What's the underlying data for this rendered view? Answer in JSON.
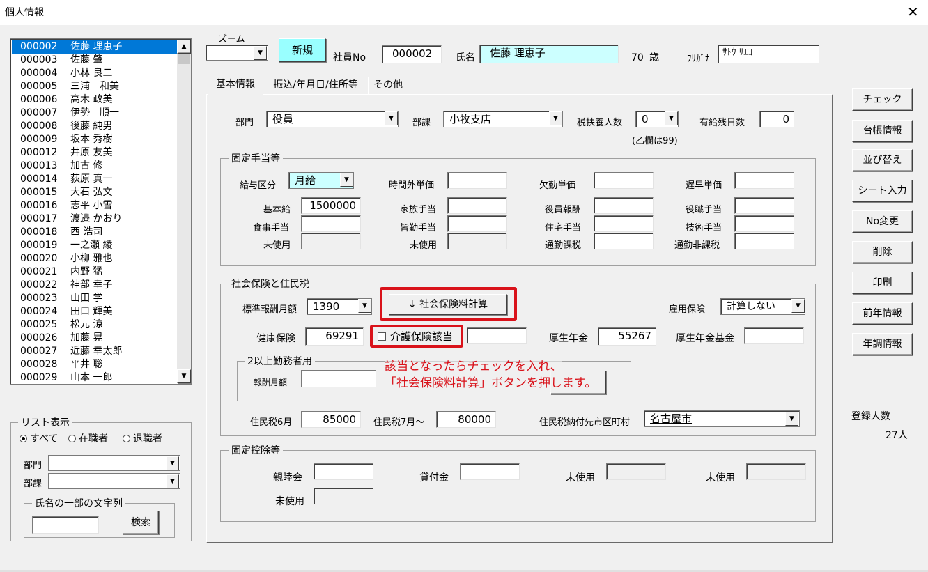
{
  "window": {
    "title": "個人情報"
  },
  "employee_list": [
    {
      "id": "000002",
      "name": "佐藤 理恵子",
      "selected": true
    },
    {
      "id": "000003",
      "name": "佐藤 肇"
    },
    {
      "id": "000004",
      "name": "小林 良二"
    },
    {
      "id": "000005",
      "name": "三浦　和美"
    },
    {
      "id": "000006",
      "name": "高木 政美"
    },
    {
      "id": "000007",
      "name": "伊勢　順一"
    },
    {
      "id": "000008",
      "name": "後藤 純男"
    },
    {
      "id": "000009",
      "name": "坂本 秀樹"
    },
    {
      "id": "000012",
      "name": "井原 友美"
    },
    {
      "id": "000013",
      "name": "加古 修"
    },
    {
      "id": "000014",
      "name": "荻原 真一"
    },
    {
      "id": "000015",
      "name": "大石 弘文"
    },
    {
      "id": "000016",
      "name": "志平 小雪"
    },
    {
      "id": "000017",
      "name": "渡邉 かおり"
    },
    {
      "id": "000018",
      "name": "西 浩司"
    },
    {
      "id": "000019",
      "name": "一之瀬 綾"
    },
    {
      "id": "000020",
      "name": "小柳 雅也"
    },
    {
      "id": "000021",
      "name": "内野 猛"
    },
    {
      "id": "000022",
      "name": "神部 幸子"
    },
    {
      "id": "000023",
      "name": "山田 学"
    },
    {
      "id": "000024",
      "name": "田口 輝美"
    },
    {
      "id": "000025",
      "name": "松元 涼"
    },
    {
      "id": "000026",
      "name": "加藤 晃"
    },
    {
      "id": "000027",
      "name": "近藤 幸太郎"
    },
    {
      "id": "000028",
      "name": "平井 聡"
    },
    {
      "id": "000029",
      "name": "山本 一郎"
    }
  ],
  "list_display": {
    "title": "リスト表示",
    "radio_all": "すべて",
    "radio_employed": "在職者",
    "radio_retired": "退職者",
    "dept_label": "部門",
    "section_label": "部課",
    "name_search_title": "氏名の一部の文字列",
    "search_button": "検索"
  },
  "header": {
    "zoom_label": "ズーム",
    "new_button": "新規",
    "employee_no_label": "社員No",
    "employee_no": "000002",
    "name_label": "氏名",
    "name": "佐藤 理恵子",
    "age": "70",
    "age_unit": "歳",
    "kana_label": "ﾌﾘｶﾞﾅ",
    "kana": "ｻﾄｳ ﾘｴｺ"
  },
  "tabs": [
    "基本情報",
    "振込/年月日/住所等",
    "その他"
  ],
  "basic": {
    "dept_label": "部門",
    "dept": "役員",
    "section_label": "部課",
    "section": "小牧支店",
    "dependents_label": "税扶養人数",
    "dependents": "0",
    "dependents_note": "(乙欄は99)",
    "paid_leave_label": "有給残日数",
    "paid_leave": "0"
  },
  "allowances": {
    "title": "固定手当等",
    "pay_type_label": "給与区分",
    "pay_type": "月給",
    "overtime_label": "時間外単価",
    "absence_label": "欠勤単価",
    "late_label": "遅早単価",
    "base_label": "基本給",
    "base": "1500000",
    "family_label": "家族手当",
    "officer_label": "役員報酬",
    "position_label": "役職手当",
    "meal_label": "食事手当",
    "attendance_label": "皆勤手当",
    "housing_label": "住宅手当",
    "skill_label": "技術手当",
    "unused_label": "未使用",
    "commute_tax_label": "通勤課税",
    "commute_nontax_label": "通勤非課税"
  },
  "insurance": {
    "title": "社会保険と住民税",
    "std_monthly_label": "標準報酬月額",
    "std_monthly": "1390",
    "calc_button": "↓  社会保険料計算",
    "employment_ins_label": "雇用保険",
    "employment_ins": "計算しない",
    "health_label": "健康保険",
    "health": "69291",
    "care_checkbox": "介護保険該当",
    "pension_label": "厚生年金",
    "pension": "55267",
    "pension_fund_label": "厚生年金基金",
    "multi_title": "2以上勤務者用",
    "multi_monthly_label": "報酬月額",
    "annotation_line1": "該当となったらチェックを入れ、",
    "annotation_line2": "「社会保険料計算」ボタンを押します。",
    "resident_june_label": "住民税6月",
    "resident_june": "85000",
    "resident_july_label": "住民税7月～",
    "resident_july": "80000",
    "resident_city_label": "住民税納付先市区町村",
    "resident_city": "名古屋市"
  },
  "deductions": {
    "title": "固定控除等",
    "mutual_label": "親睦会",
    "loan_label": "貸付金",
    "unused_label": "未使用"
  },
  "side_buttons": [
    "チェック",
    "台帳情報",
    "並び替え",
    "シート入力",
    "No変更",
    "削除",
    "印刷",
    "前年情報",
    "年調情報"
  ],
  "registered": {
    "label": "登録人数",
    "count": "27人"
  },
  "colors": {
    "selection": "#0078d7",
    "highlight_field": "#ccffff",
    "new_button": "#99ffff",
    "annotation_red": "#d9121a"
  }
}
